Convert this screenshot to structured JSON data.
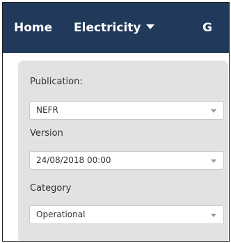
{
  "nav": {
    "home": "Home",
    "electricity": "Electricity",
    "next_partial": "G"
  },
  "form": {
    "publication": {
      "label": "Publication:",
      "value": "NEFR"
    },
    "version": {
      "label": "Version",
      "value": "24/08/2018 00:00"
    },
    "category": {
      "label": "Category",
      "value": "Operational"
    }
  },
  "icons": {
    "nav_dropdown": "caret-down-icon",
    "select_dropdown": "chevron-down-icon"
  },
  "colors": {
    "navbar": "#213a5c",
    "panel": "#e2e2e2",
    "text": "#333333"
  }
}
